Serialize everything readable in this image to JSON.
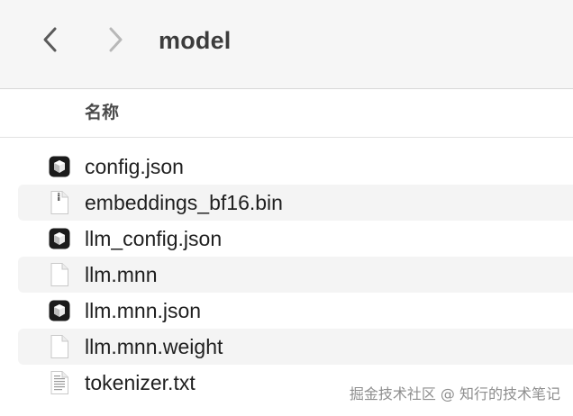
{
  "window": {
    "title": "model"
  },
  "toolbar": {
    "back_icon": "chevron-left-icon",
    "forward_icon": "chevron-right-icon"
  },
  "list_header": {
    "name_column": "名称"
  },
  "files": [
    {
      "name": "config.json",
      "icon": "json-file-icon"
    },
    {
      "name": "embeddings_bf16.bin",
      "icon": "binary-file-icon"
    },
    {
      "name": "llm_config.json",
      "icon": "json-file-icon"
    },
    {
      "name": "llm.mnn",
      "icon": "blank-file-icon"
    },
    {
      "name": "llm.mnn.json",
      "icon": "json-file-icon"
    },
    {
      "name": "llm.mnn.weight",
      "icon": "blank-file-icon"
    },
    {
      "name": "tokenizer.txt",
      "icon": "text-file-icon"
    }
  ],
  "watermark": "掘金技术社区 @ 知行的技术笔记",
  "colors": {
    "toolbar_bg": "#f6f6f6",
    "row_alt_bg": "#f4f4f4",
    "forward_disabled": "#b8b8b8",
    "back_enabled": "#5a5a5a"
  }
}
